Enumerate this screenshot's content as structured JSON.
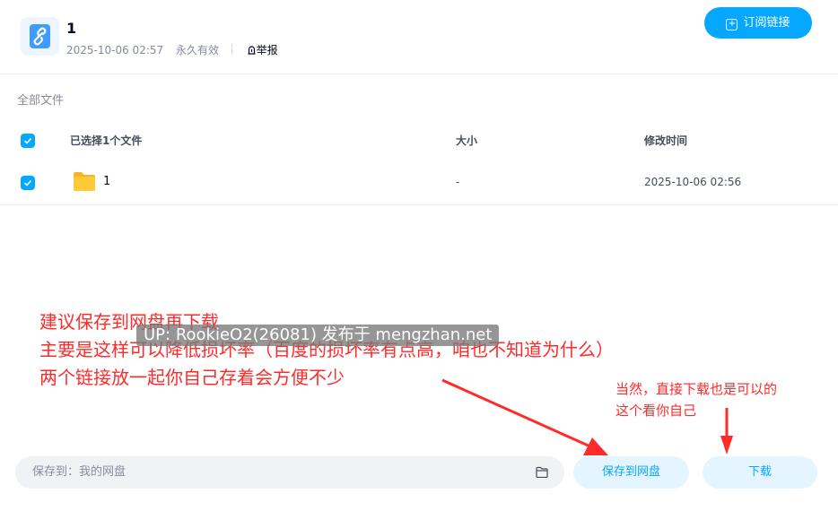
{
  "header": {
    "title": "1",
    "date": "2025-10-06 02:57",
    "validity": "永久有效",
    "report": "举报",
    "subscribe_label": "订阅链接"
  },
  "file_list": {
    "breadcrumb": "全部文件",
    "columns": {
      "name": "已选择1个文件",
      "size": "大小",
      "modified": "修改时间"
    },
    "rows": [
      {
        "name": "1",
        "size": "-",
        "modified": "2025-10-06 02:56",
        "checked": true
      }
    ]
  },
  "footer": {
    "save_path": "保存到：我的网盘",
    "save_button": "保存到网盘",
    "download_button": "下载"
  },
  "annotations": {
    "main_lines": [
      "建议保存到网盘再下载",
      "主要是这样可以降低损坏率（百度的损坏率有点高，咱也不知道为什么）",
      "两个链接放一起你自己存着会方便不少"
    ],
    "side_lines": [
      "当然，直接下载也是可以的",
      "这个看你自己"
    ],
    "watermark": "UP: RookieO2(26081) 发布于 mengzhan.net"
  },
  "colors": {
    "accent": "#06a7ff",
    "annotation_red": "#ff2a2a",
    "folder_yellow": "#ffc937"
  }
}
